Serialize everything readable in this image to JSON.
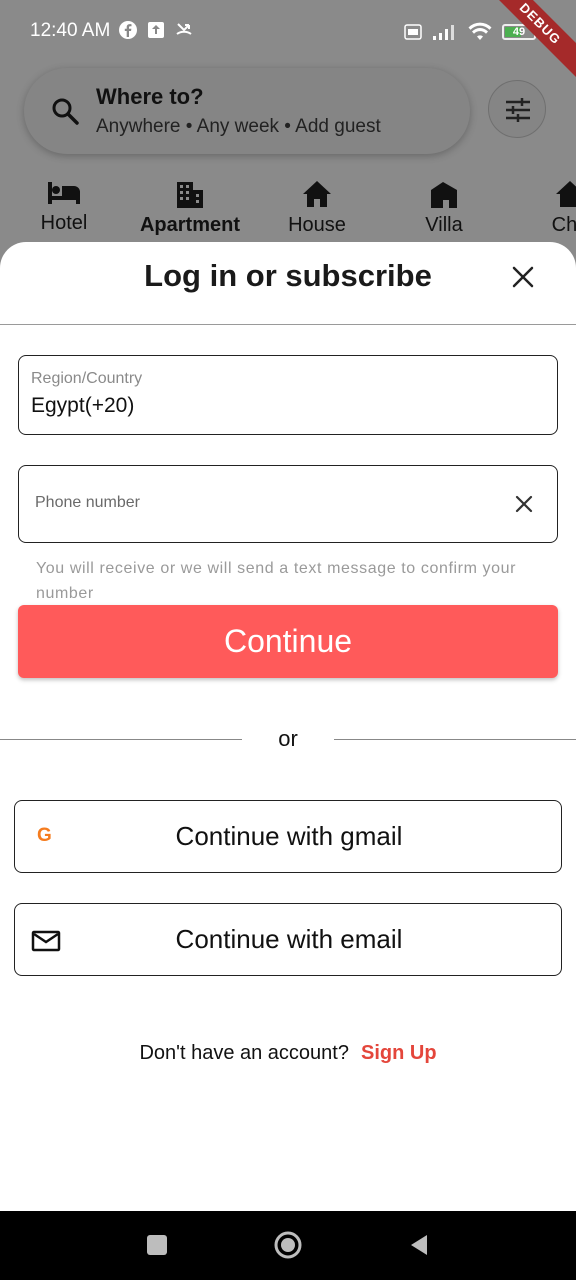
{
  "status_bar": {
    "time": "12:40 AM",
    "battery": "49",
    "debug_label": "DEBUG"
  },
  "search": {
    "title": "Where to?",
    "subtitle": "Anywhere • Any week • Add guest"
  },
  "categories": [
    {
      "label": "Hotel",
      "icon": "bed-icon"
    },
    {
      "label": "Apartment",
      "icon": "building-icon"
    },
    {
      "label": "House",
      "icon": "house-icon"
    },
    {
      "label": "Villa",
      "icon": "villa-icon"
    },
    {
      "label": "Cha",
      "icon": "chalet-icon"
    }
  ],
  "sheet": {
    "title": "Log in or subscribe",
    "region_label": "Region/Country",
    "region_value": "Egypt(+20)",
    "phone_placeholder": "Phone number",
    "helper_text": "You will receive or we will send a text message to confirm your number",
    "continue_label": "Continue",
    "or_label": "or",
    "gmail_label": "Continue with gmail",
    "email_label": "Continue with email",
    "signup_prompt": "Don't have an account?",
    "signup_link": "Sign Up"
  },
  "colors": {
    "accent": "#ff5a5a",
    "link": "#e4463b"
  }
}
